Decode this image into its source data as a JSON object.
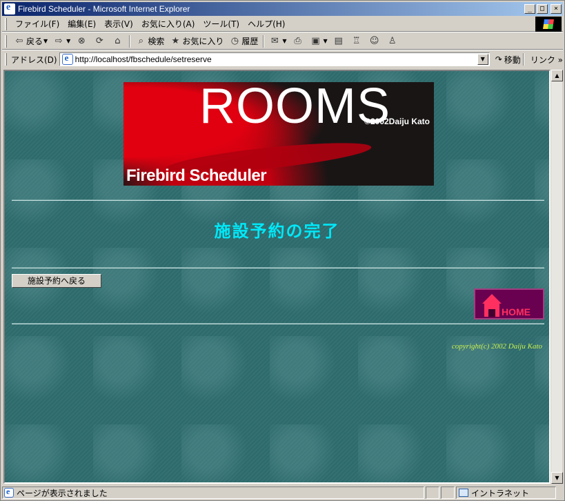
{
  "window": {
    "title": "Firebird Scheduler - Microsoft Internet Explorer",
    "controls": {
      "minimize": "_",
      "maximize": "□",
      "close": "×"
    }
  },
  "menu": {
    "items": [
      "ファイル(F)",
      "編集(E)",
      "表示(V)",
      "お気に入り(A)",
      "ツール(T)",
      "ヘルプ(H)"
    ]
  },
  "toolbar": {
    "back": "戻る",
    "search": "検索",
    "favorites": "お気に入り",
    "history": "履歴"
  },
  "addressbar": {
    "label": "アドレス(D)",
    "url": "http://localhost/fbschedule/setreserve",
    "go": "移動",
    "links": "リンク"
  },
  "page": {
    "banner": {
      "title": "ROOMS",
      "copyright": "©2002Daiju Kato",
      "subtitle": "Firebird Scheduler"
    },
    "heading": "施設予約の完了",
    "back_button": "施設予約へ戻る",
    "home_label": "HOME",
    "copyright": "copyright(c) 2002 Daiju Kato"
  },
  "status": {
    "text": "ページが表示されました",
    "zone": "イントラネット"
  },
  "colors": {
    "background": "#2d6a6c",
    "heading": "#00e8f8",
    "copyright": "#c8f050",
    "home_box": "#6a0050",
    "home_accent": "#ff3060"
  }
}
